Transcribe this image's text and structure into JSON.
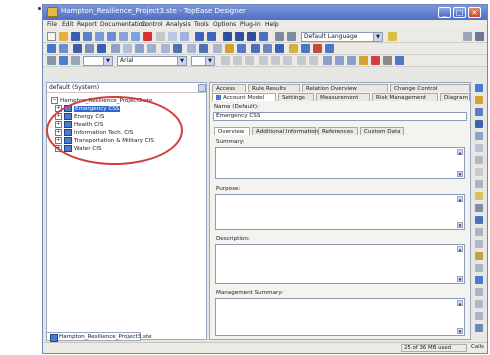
{
  "window": {
    "title": "Hampton_Resilience_Project3.ste - TopEase Designer",
    "controls": [
      "_",
      "□",
      "×"
    ]
  },
  "menu": [
    "File",
    "Edit",
    "Report",
    "Documentation",
    "Control",
    "Analysis",
    "Tools",
    "Options",
    "Plug-In",
    "Help"
  ],
  "toolbar": {
    "language_combo": "Default Language",
    "font_combo": "Arial"
  },
  "tree": {
    "scope_combo": "default (System)",
    "root": "Hampton_Resilience_Project3.ste",
    "items": [
      {
        "label": "Emergency CSS",
        "selected": true
      },
      {
        "label": "Energy CIS",
        "selected": false
      },
      {
        "label": "Health CIS",
        "selected": false
      },
      {
        "label": "Information Tech. CIS",
        "selected": false
      },
      {
        "label": "Transportation & Military CIS",
        "selected": false
      },
      {
        "label": "Water CIS",
        "selected": false
      }
    ]
  },
  "top_tabs": [
    "Access",
    "Rule Results",
    "Relation Overview",
    "Change Control"
  ],
  "main_tabs": [
    "Account Model",
    "Settings",
    "Measurement",
    "Risk Management",
    "Diagram"
  ],
  "name_field": {
    "label": "Name (Default):",
    "value": "Emergency CSS"
  },
  "sub_tabs": [
    "Overview",
    "Additional Information",
    "References",
    "Custom Data"
  ],
  "fields": [
    {
      "label": "Summary:"
    },
    {
      "label": "Purpose:"
    },
    {
      "label": "Description:"
    },
    {
      "label": "Management Summary:"
    }
  ],
  "doc_tab": "Hampton_Resilience_Project3.ste",
  "status": {
    "memory": "25 of 36 MB used",
    "mode": "Calls"
  },
  "colors": {
    "annotation_circle": "#d23d3d",
    "selection": "#3367d0",
    "titlebar": "#4f6ec6"
  }
}
